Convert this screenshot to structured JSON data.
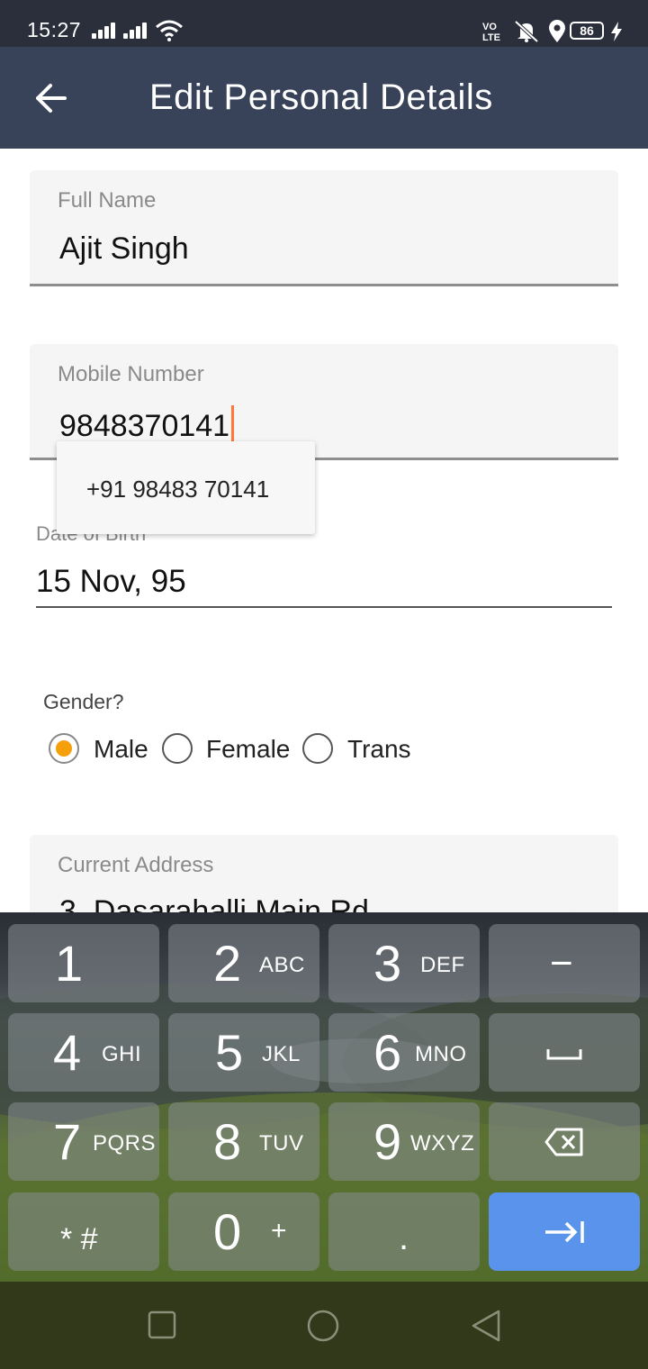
{
  "status_bar": {
    "time": "15:27",
    "volte": "VO\nLTE",
    "battery": "86",
    "icons": [
      "signal-icon",
      "signal-icon",
      "wifi-icon",
      "volte-icon",
      "mute-icon",
      "location-icon",
      "battery-icon",
      "charging-icon"
    ]
  },
  "app_bar": {
    "back_icon": "arrow-left-icon",
    "title": "Edit Personal Details"
  },
  "form": {
    "full_name": {
      "label": "Full Name",
      "value": "Ajit Singh"
    },
    "mobile": {
      "label": "Mobile Number",
      "value": "9848370141"
    },
    "autocomplete_suggestion": "+91 98483 70141",
    "dob": {
      "label": "Date of Birth",
      "value": "15 Nov, 95"
    },
    "gender": {
      "label": "Gender?",
      "options": [
        "Male",
        "Female",
        "Trans"
      ],
      "selected": "Male"
    },
    "address": {
      "label": "Current Address",
      "value": "3, Dasarahalli Main Rd"
    }
  },
  "keyboard": {
    "keys": [
      {
        "main": "1",
        "sub": ""
      },
      {
        "main": "2",
        "sub": "ABC"
      },
      {
        "main": "3",
        "sub": "DEF"
      },
      {
        "main": "−",
        "sub": ""
      },
      {
        "main": "4",
        "sub": "GHI"
      },
      {
        "main": "5",
        "sub": "JKL"
      },
      {
        "main": "6",
        "sub": "MNO"
      },
      {
        "main": "␣",
        "sub": ""
      },
      {
        "main": "7",
        "sub": "PQRS"
      },
      {
        "main": "8",
        "sub": "TUV"
      },
      {
        "main": "9",
        "sub": "WXYZ"
      },
      {
        "main": "⌫",
        "sub": ""
      },
      {
        "main": "* #",
        "sub": ""
      },
      {
        "main": "0",
        "sub": "+"
      },
      {
        "main": ".",
        "sub": ""
      },
      {
        "main": "⇥",
        "sub": ""
      }
    ],
    "accent": "#5a93ec"
  },
  "colors": {
    "status_bar": "#2b2f3b",
    "app_bar": "#384259",
    "radio_selected": "#f5a00a",
    "caret": "#ff7a3a"
  },
  "nav_bar": {
    "icons": [
      "square-recents-icon",
      "circle-home-icon",
      "triangle-back-icon"
    ]
  }
}
